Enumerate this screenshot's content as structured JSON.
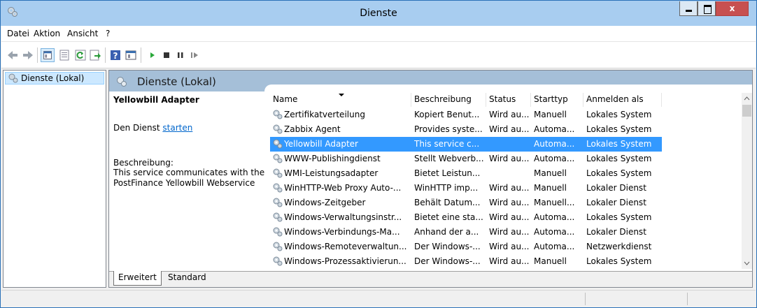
{
  "window": {
    "title": "Dienste"
  },
  "menu": [
    "Datei",
    "Aktion",
    "Ansicht",
    "?"
  ],
  "toolbar": {
    "icons": [
      "back-arrow-icon",
      "forward-arrow-icon",
      "show-hide-console-tree-icon",
      "properties-icon",
      "refresh-icon",
      "export-list-icon",
      "help-icon",
      "console-icon",
      "play-icon",
      "stop-icon",
      "pause-icon",
      "resume-icon"
    ]
  },
  "tree": {
    "root_label": "Dienste (Lokal)"
  },
  "pane": {
    "title": "Dienste (Lokal)",
    "detail_title": "Yellowbill Adapter",
    "start_prefix": "Den Dienst ",
    "start_link": "starten",
    "desc_label": "Beschreibung:",
    "desc_text": "This service communicates with the PostFinance Yellowbill Webservice"
  },
  "columns": [
    "Name",
    "Beschreibung",
    "Status",
    "Starttyp",
    "Anmelden als"
  ],
  "rows": [
    {
      "name": "Zertifikatverteilung",
      "desc": "Kopiert Benut...",
      "status": "Wird au...",
      "start": "Manuell",
      "logon": "Lokales System"
    },
    {
      "name": "Zabbix Agent",
      "desc": "Provides syste...",
      "status": "Wird au...",
      "start": "Automa...",
      "logon": "Lokales System"
    },
    {
      "name": "Yellowbill Adapter",
      "desc": "This service c...",
      "status": "",
      "start": "Automa...",
      "logon": "Lokales System"
    },
    {
      "name": "WWW-Publishingdienst",
      "desc": "Stellt Webverb...",
      "status": "Wird au...",
      "start": "Automa...",
      "logon": "Lokales System"
    },
    {
      "name": "WMI-Leistungsadapter",
      "desc": "Bietet Leistun...",
      "status": "",
      "start": "Manuell",
      "logon": "Lokales System"
    },
    {
      "name": "WinHTTP-Web Proxy Auto-...",
      "desc": "WinHTTP imp...",
      "status": "Wird au...",
      "start": "Manuell",
      "logon": "Lokaler Dienst"
    },
    {
      "name": "Windows-Zeitgeber",
      "desc": "Behält Datum...",
      "status": "Wird au...",
      "start": "Manuell...",
      "logon": "Lokaler Dienst"
    },
    {
      "name": "Windows-Verwaltungsinstr...",
      "desc": "Bietet eine sta...",
      "status": "Wird au...",
      "start": "Automa...",
      "logon": "Lokales System"
    },
    {
      "name": "Windows-Verbindungs-Ma...",
      "desc": "Anhand der a...",
      "status": "Wird au...",
      "start": "Automa...",
      "logon": "Lokaler Dienst"
    },
    {
      "name": "Windows-Remoteverwaltun...",
      "desc": "Der Windows-...",
      "status": "Wird au...",
      "start": "Automa...",
      "logon": "Netzwerkdienst"
    },
    {
      "name": "Windows-Prozessaktivierun...",
      "desc": "Der Windows-...",
      "status": "Wird au...",
      "start": "Manuell",
      "logon": "Lokales System"
    }
  ],
  "selected_row": 2,
  "tabs": [
    "Erweitert",
    "Standard"
  ],
  "colors": {
    "titlebar": "#a8cdf0",
    "close": "#c75050",
    "selection": "#3399ff",
    "header_band": "#a5bfd8",
    "link": "#0066cc"
  }
}
